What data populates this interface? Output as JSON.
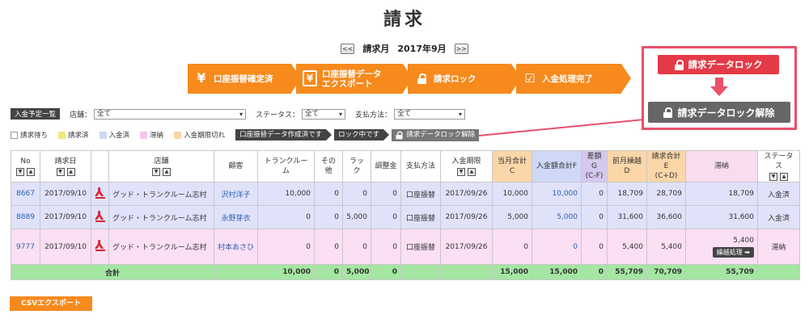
{
  "page_title": "請求",
  "month_nav": {
    "prev_label": "<<",
    "next_label": ">>",
    "label": "請求月",
    "month": "2017年9月"
  },
  "steps": [
    {
      "icon": "¥",
      "label": "口座振替確定済"
    },
    {
      "icon": "¥",
      "label": "口座振替データ\nエクスポート"
    },
    {
      "icon": "lock",
      "label": "請求ロック"
    },
    {
      "icon": "check",
      "label": "入金処理完了"
    }
  ],
  "lock_legend": {
    "lock_label": "請求データロック",
    "unlock_label": "請求データロック解除"
  },
  "filters": {
    "tag": "入金予定一覧",
    "store_label": "店舗：",
    "store_value": "全て",
    "status_label": "ステータス：",
    "status_value": "全て",
    "payment_label": "支払方法：",
    "payment_value": "全て"
  },
  "legend": [
    {
      "label": "請求待ち",
      "color": "#ffffff"
    },
    {
      "label": "請求済",
      "color": "#f2e57a"
    },
    {
      "label": "入金済",
      "color": "#cfd8f6"
    },
    {
      "label": "滞納",
      "color": "#f7c6ec"
    },
    {
      "label": "入金期限切れ",
      "color": "#fbd6a9"
    }
  ],
  "legend_status": {
    "exported": "口座振替データ作成済です",
    "locked": "ロック中です",
    "unlock": "請求データロック解除"
  },
  "table": {
    "headers": {
      "no": "No",
      "date": "請求日",
      "store": "店舗",
      "customer": "顧客",
      "trunk": "トランクルーム",
      "other": "その他",
      "rack": "ラック",
      "adjust": "調整金",
      "payment": "支払方法",
      "deadline": "入金期限",
      "total_c": "当月合計C",
      "paid_f": "入金額合計F",
      "diff_g": "差額G\n(C-F)",
      "carry_d": "前月繰越D",
      "billed_e": "請求合計E\n(C+D)",
      "arrears": "滞納",
      "status": "ステータス"
    },
    "rows": [
      {
        "no": "8667",
        "date": "2017/09/10",
        "store": "グッド・トランクルーム志村",
        "customer": "沢村洋子",
        "trunk": "10,000",
        "other": "0",
        "rack": "0",
        "adjust": "0",
        "payment": "口座振替",
        "deadline": "2017/09/26",
        "total_c": "10,000",
        "paid_f": "10,000",
        "diff_g": "0",
        "carry_d": "18,709",
        "billed_e": "28,709",
        "arrears": "18,709",
        "status": "入金済"
      },
      {
        "no": "8889",
        "date": "2017/09/10",
        "store": "グッド・トランクルーム志村",
        "customer": "永野芽衣",
        "trunk": "0",
        "other": "0",
        "rack": "5,000",
        "adjust": "0",
        "payment": "口座振替",
        "deadline": "2017/09/26",
        "total_c": "5,000",
        "paid_f": "5,000",
        "diff_g": "0",
        "carry_d": "31,600",
        "billed_e": "36,600",
        "arrears": "31,600",
        "status": "入金済"
      },
      {
        "no": "9777",
        "date": "2017/09/10",
        "store": "グッド・トランクルーム志村",
        "customer": "村本あさひ",
        "trunk": "0",
        "other": "0",
        "rack": "0",
        "adjust": "0",
        "payment": "口座振替",
        "deadline": "2017/09/26",
        "total_c": "0",
        "paid_f": "0",
        "diff_g": "0",
        "carry_d": "5,400",
        "billed_e": "5,400",
        "arrears": "5,400",
        "status": "滞納"
      }
    ],
    "carry_button": "繰越処理 ➡",
    "totals": {
      "label": "合計",
      "trunk": "10,000",
      "other": "0",
      "rack": "5,000",
      "adjust": "0",
      "total_c": "15,000",
      "paid_f": "15,000",
      "diff_g": "0",
      "carry_d": "55,709",
      "billed_e": "70,709",
      "arrears": "55,709"
    }
  },
  "csv_export": "CSVエクスポート"
}
